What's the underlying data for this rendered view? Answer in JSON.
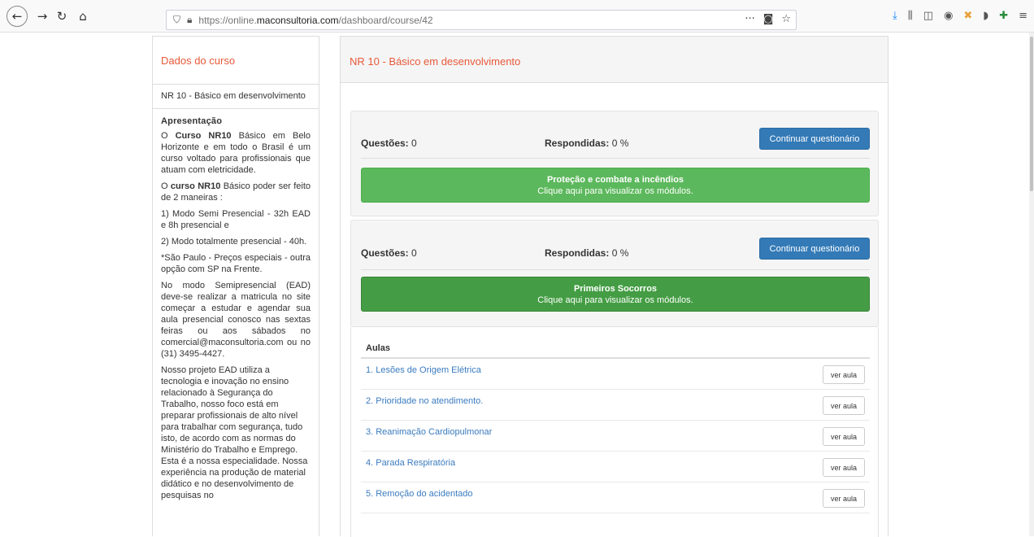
{
  "browser": {
    "url_prefix": "https://online.",
    "url_domain": "maconsultoria.com",
    "url_path": "/dashboard/course/42"
  },
  "sidebar": {
    "heading": "Dados do curso",
    "course_name": "NR 10 - Básico em desenvolvimento",
    "section_title": "Apresentação",
    "p1_pre": "O ",
    "p1_bold": "Curso NR10",
    "p1_post": " Básico em Belo Horizonte e em todo o Brasil é um curso voltado para profissionais que atuam com eletricidade.",
    "p2_pre": "O ",
    "p2_bold": "curso NR10",
    "p2_post": " Básico poder ser feito de 2 maneiras :",
    "p3": "1) Modo Semi Presencial - 32h EAD e 8h presencial e",
    "p4": "2) Modo totalmente presencial - 40h.",
    "p5": "*São Paulo - Preços especiais - outra opção com SP na Frente.",
    "p6": "No modo Semipresencial (EAD) deve-se realizar a matricula no site começar a estudar e agendar sua aula presencial conosco nas sextas feiras ou aos sábados no comercial@maconsultoria.com ou no (31) 3495-4427.",
    "p7": "Nosso projeto EAD utiliza a tecnologia e inovação no ensino relacionado à Segurança do Trabalho, nosso foco está em preparar profissionais de alto nível para trabalhar com segurança, tudo isto, de acordo com as normas do Ministério do Trabalho e Emprego. Esta é a nossa especialidade. Nossa experiência na produção de material didático e no desenvolvimento de pesquisas no"
  },
  "main": {
    "title": "NR 10 - Básico em desenvolvimento",
    "questoes_label": "Questões:",
    "respondidas_label": "Respondidas:",
    "continue_label": "Continuar questionário",
    "modules_hint": "Clique aqui para visualizar os módulos.",
    "blocks": [
      {
        "questoes": "0",
        "respondidas": "0 %",
        "module_title": "Proteção e combate a incêndios"
      },
      {
        "questoes": "0",
        "respondidas": "0 %",
        "module_title": "Primeiros Socorros"
      }
    ],
    "aulas_title": "Aulas",
    "ver_aula_label": "ver aula",
    "aulas": [
      "1. Lesões de Origem Elétrica",
      "2. Prioridade no atendimento.",
      "3. Reanimação Cardiopulmonar",
      "4. Parada Respiratória",
      "5. Remoção do acidentado"
    ]
  },
  "colors": {
    "accent": "#e8593a",
    "primary_button": "#337ab7",
    "module_light": "#5cb85c",
    "module_dark": "#449d44",
    "link": "#3a7bbf"
  }
}
